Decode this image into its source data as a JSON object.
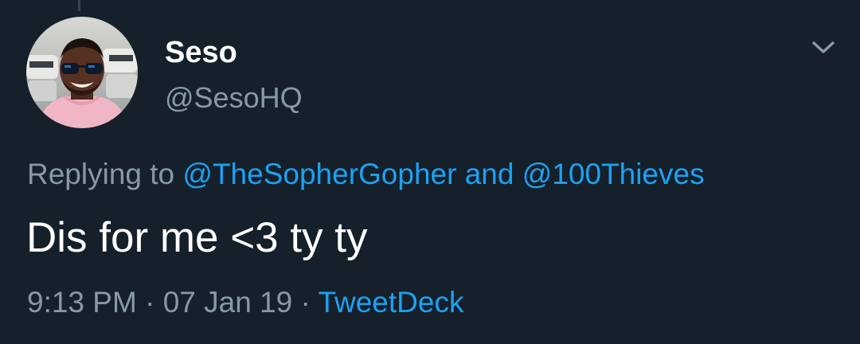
{
  "colors": {
    "background": "#15202b",
    "primary_text": "#ffffff",
    "secondary_text": "#8899a6",
    "accent_link": "#1da1f2",
    "thread_line": "#38444d"
  },
  "tweet": {
    "author": {
      "display_name": "Seso",
      "handle": "@SesoHQ",
      "avatar_icon": "profile-photo"
    },
    "menu_icon": "chevron-down-icon",
    "reply": {
      "prefix": "Replying to",
      "mention_1": "@TheSopherGopher",
      "conjunction": "and",
      "mention_2": "@100Thieves"
    },
    "text": "Dis for me <3 ty ty",
    "meta": {
      "time": "9:13 PM",
      "separator": "·",
      "date": "07 Jan 19",
      "source": "TweetDeck"
    }
  }
}
